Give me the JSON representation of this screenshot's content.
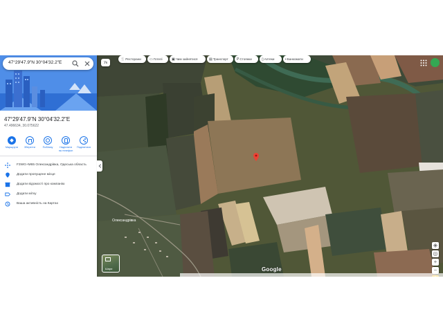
{
  "search": {
    "value": "47°29'47.9\"N 30°04'32.2\"E"
  },
  "place": {
    "title": "47°29'47.9\"N 30°04'32.2\"E",
    "decimal": "47.496634, 30.075622"
  },
  "actions": [
    {
      "label1": "Маршрути",
      "label2": "",
      "icon": "directions-icon"
    },
    {
      "label1": "Зберегти",
      "label2": "",
      "icon": "bookmark-icon"
    },
    {
      "label1": "Поблизу",
      "label2": "",
      "icon": "nearby-icon"
    },
    {
      "label1": "Надіслати",
      "label2": "на телефон",
      "icon": "send-to-phone-icon"
    },
    {
      "label1": "Поділитися",
      "label2": "",
      "icon": "share-icon"
    }
  ],
  "rows": [
    {
      "text": "F3WG+M65 Олександрівка, Одеська область",
      "icon": "plus-code-icon"
    },
    {
      "text": "Додати пропущене місце",
      "icon": "add-place-icon"
    },
    {
      "text": "Додати відомості про компанію",
      "icon": "add-business-icon"
    },
    {
      "text": "Додати мітку",
      "icon": "label-icon"
    },
    {
      "text": "Ваша активність на Картах",
      "icon": "history-icon"
    }
  ],
  "chips": [
    {
      "label": "Ресторани",
      "icon": "restaurant-icon"
    },
    {
      "label": "Готелі",
      "icon": "hotel-icon"
    },
    {
      "label": "Чим зайнятися",
      "icon": "attractions-icon"
    },
    {
      "label": "Транспорт",
      "icon": "transit-icon"
    },
    {
      "label": "Стоянки",
      "icon": "parking-icon"
    },
    {
      "label": "Аптеки",
      "icon": "pharmacy-icon"
    },
    {
      "label": "Банкомати",
      "icon": "atm-icon"
    }
  ],
  "map": {
    "village_label": "Олександрівка",
    "layers_label": "Шари",
    "brand": "Google",
    "pin_color": "#ea4335",
    "accent_color": "#1a73e8"
  }
}
